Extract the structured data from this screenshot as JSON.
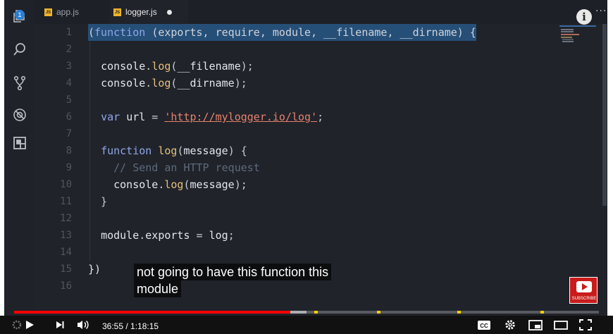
{
  "activity_bar": {
    "items": [
      {
        "name": "explorer",
        "icon": "files-icon",
        "badge": "1"
      },
      {
        "name": "search",
        "icon": "search-icon"
      },
      {
        "name": "source-control",
        "icon": "git-branch-icon"
      },
      {
        "name": "debug",
        "icon": "bug-icon"
      },
      {
        "name": "extensions",
        "icon": "extensions-icon"
      }
    ]
  },
  "tabs": [
    {
      "label": "app.js",
      "active": false,
      "icon": "js-icon"
    },
    {
      "label": "logger.js",
      "active": true,
      "modified": true,
      "icon": "js-icon"
    }
  ],
  "js_icon_text": "JS",
  "editor": {
    "lines": [
      {
        "num": "1",
        "text": "(function (exports, require, module, __filename, __dirname) {"
      },
      {
        "num": "2",
        "text": ""
      },
      {
        "num": "3",
        "text": "  console.log(__filename);"
      },
      {
        "num": "4",
        "text": "  console.log(__dirname);"
      },
      {
        "num": "5",
        "text": ""
      },
      {
        "num": "6",
        "text": "  var url = 'http://mylogger.io/log';"
      },
      {
        "num": "7",
        "text": ""
      },
      {
        "num": "8",
        "text": "  function log(message) {"
      },
      {
        "num": "9",
        "text": "    // Send an HTTP request"
      },
      {
        "num": "10",
        "text": "    console.log(message);"
      },
      {
        "num": "11",
        "text": "  }"
      },
      {
        "num": "12",
        "text": ""
      },
      {
        "num": "13",
        "text": "  module.exports = log;"
      },
      {
        "num": "14",
        "text": ""
      },
      {
        "num": "15",
        "text": "})"
      },
      {
        "num": "16",
        "text": ""
      }
    ]
  },
  "caption": {
    "line1": "not going to have this function this",
    "line2": "module"
  },
  "subscribe_label": "SUBSCRIBE",
  "player": {
    "current_time": "36:55",
    "duration": "1:18:15",
    "time_display": "36:55 / 1:18:15",
    "played_fraction": 0.472,
    "buffered_fraction": 0.5,
    "chapter_fractions": [
      0.513,
      0.62,
      0.758,
      0.9
    ],
    "cc_label": "CC"
  },
  "colors": {
    "editor_bg": "#20232a",
    "selection": "#264f78",
    "keyword": "#8fa7e8",
    "function": "#e5c07b",
    "string": "#e5826d",
    "comment": "#5e6a7a",
    "progress_played": "#ff0000",
    "subscribe_red": "#c91b1b"
  }
}
